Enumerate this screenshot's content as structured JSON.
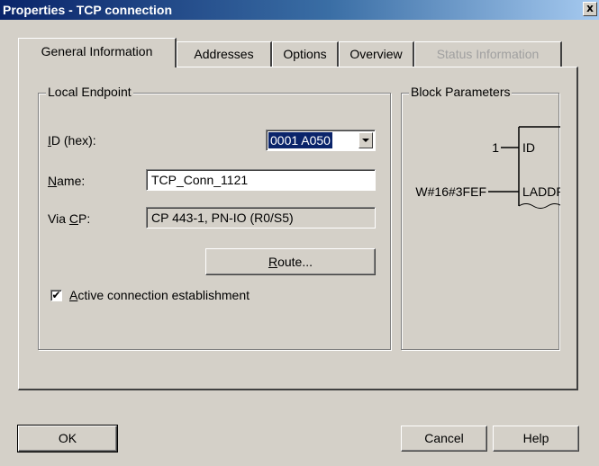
{
  "window": {
    "title": "Properties - TCP connection",
    "close_glyph": "x"
  },
  "tabs": [
    {
      "label": "General Information",
      "state": "active"
    },
    {
      "label": "Addresses",
      "state": "normal"
    },
    {
      "label": "Options",
      "state": "normal"
    },
    {
      "label": "Overview",
      "state": "normal"
    },
    {
      "label": "Status Information",
      "state": "disabled"
    }
  ],
  "local_endpoint": {
    "group_title": "Local Endpoint",
    "id_label_mnemonic": "I",
    "id_label_rest": "D (hex):",
    "id_value": "0001 A050",
    "name_label_mnemonic": "N",
    "name_label_rest": "ame:",
    "name_value": "TCP_Conn_1121",
    "via_label_prefix": "Via ",
    "via_label_mnemonic": "C",
    "via_label_rest": "P:",
    "via_value": "CP 443-1, PN-IO (R0/S5)",
    "route_mnemonic": "R",
    "route_rest": "oute...",
    "active_conn_mnemonic": "A",
    "active_conn_rest": "ctive connection establishment",
    "active_conn_checked": true,
    "check_glyph": "✔"
  },
  "block_parameters": {
    "group_title": "Block Parameters",
    "id_input_value": "1",
    "id_pin": "ID",
    "laddr_input_value": "W#16#3FEF",
    "laddr_pin": "LADDR"
  },
  "footer": {
    "ok_label": "OK",
    "cancel_label": "Cancel",
    "help_label": "Help"
  },
  "colors": {
    "face": "#d4d0c8",
    "title_start": "#0a246a",
    "title_end": "#a6caf0",
    "selection": "#0a246a"
  }
}
